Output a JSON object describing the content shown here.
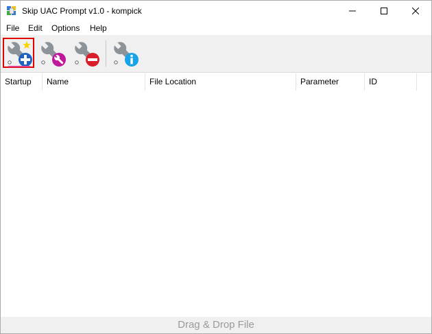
{
  "window": {
    "title": "Skip UAC Prompt v1.0 - kompick"
  },
  "menu": {
    "file": "File",
    "edit": "Edit",
    "options": "Options",
    "help": "Help"
  },
  "toolbar": {
    "buttons": [
      {
        "icon": "wrench-add-icon",
        "selected": true
      },
      {
        "icon": "wrench-edit-icon"
      },
      {
        "icon": "wrench-remove-icon"
      },
      {
        "icon": "wrench-info-icon"
      }
    ]
  },
  "list": {
    "columns": [
      "Startup",
      "Name",
      "File Location",
      "Parameter",
      "ID"
    ],
    "rows": []
  },
  "status": {
    "drop_hint": "Drag & Drop File"
  },
  "colors": {
    "add_badge": "#1e63c4",
    "edit_badge": "#c0189a",
    "remove_badge": "#d81e2a",
    "info_badge": "#1aa3e6",
    "star": "#f5d400",
    "highlight": "#e00000",
    "wrench": "#8c9399"
  }
}
